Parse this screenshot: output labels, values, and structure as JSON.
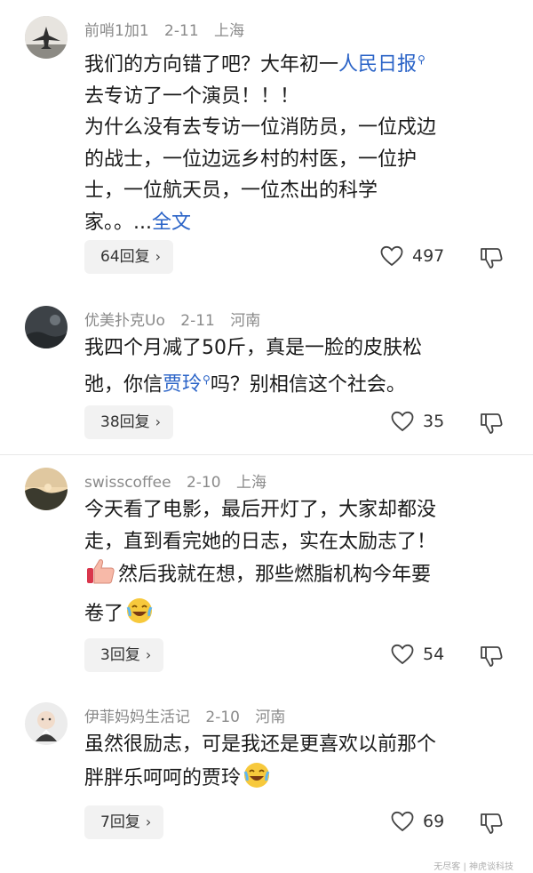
{
  "comments": [
    {
      "username": "前哨1加1",
      "date": "2-11",
      "location": "上海",
      "line1_pre": "我们的方向错了吧？大年初一",
      "line1_link": "人民日报",
      "line2": "去专访了一个演员！！！",
      "line3": "为什么没有去专访一位消防员，一位戍边",
      "line4": "的战士，一位边远乡村的村医，一位护",
      "line5": "士，一位航天员，一位杰出的科学",
      "line6_pre": "家。。...",
      "line6_link": "全文",
      "reply": "64回复",
      "likes": "497"
    },
    {
      "username": "优美扑克Uo",
      "date": "2-11",
      "location": "河南",
      "line1": "我四个月减了50斤，真是一脸的皮肤松",
      "line2_pre": "弛，你信",
      "line2_link": "贾玲",
      "line2_post": "吗？别相信这个社会。",
      "reply": "38回复",
      "likes": "35"
    },
    {
      "username": "swisscoffee",
      "date": "2-10",
      "location": "上海",
      "line1": "今天看了电影，最后开灯了，大家却都没",
      "line2": "走，直到看完她的日志，实在太励志了！",
      "line3": "然后我就在想，那些燃脂机构今年要",
      "line4": "卷了",
      "reply": "3回复",
      "likes": "54"
    },
    {
      "username": "伊菲妈妈生活记",
      "date": "2-10",
      "location": "河南",
      "line1": "虽然很励志，可是我还是更喜欢以前那个",
      "line2": "胖胖乐呵呵的贾玲",
      "reply": "7回复",
      "likes": "69"
    }
  ],
  "icons": {
    "search": "search-icon",
    "heart": "heart-icon",
    "dislike": "thumbs-down-icon",
    "chevron": "chevron-right-icon"
  },
  "colors": {
    "link": "#2a63c7",
    "meta": "#8a8a8a"
  },
  "watermark": "无尽客 | 神虎谈科技"
}
